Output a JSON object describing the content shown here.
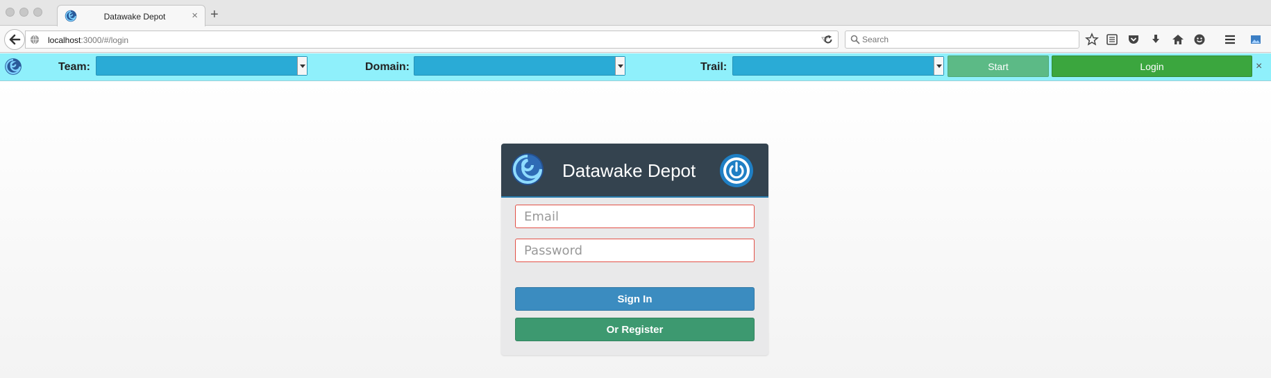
{
  "browser": {
    "tab_title": "Datawake Depot",
    "tab_close": "×",
    "new_tab": "+",
    "url_host": "localhost",
    "url_path": ":3000/#/login",
    "search_placeholder": "Search"
  },
  "toolbar": {
    "team_label": "Team:",
    "domain_label": "Domain:",
    "trail_label": "Trail:",
    "team_value": "",
    "domain_value": "",
    "trail_value": "",
    "start_label": "Start",
    "login_label": "Login",
    "close_glyph": "×"
  },
  "login": {
    "title": "Datawake Depot",
    "email_placeholder": "Email",
    "password_placeholder": "Password",
    "signin_label": "Sign In",
    "register_label": "Or Register"
  },
  "colors": {
    "toolbar_bg": "#8ff0fb",
    "select_bg": "#2aabd6",
    "start_btn": "#5cba86",
    "login_btn": "#3ba63e",
    "panel_header": "#34434f",
    "signin_btn": "#3b8cc0",
    "register_btn": "#3d9970",
    "field_border": "#e24f45"
  },
  "icons": [
    "datawake-logo-icon",
    "back-arrow-icon",
    "globe-icon",
    "reload-icon",
    "search-icon",
    "star-icon",
    "reading-list-icon",
    "pocket-icon",
    "download-icon",
    "home-icon",
    "smiley-icon",
    "hamburger-menu-icon",
    "picture-icon",
    "power-icon"
  ]
}
